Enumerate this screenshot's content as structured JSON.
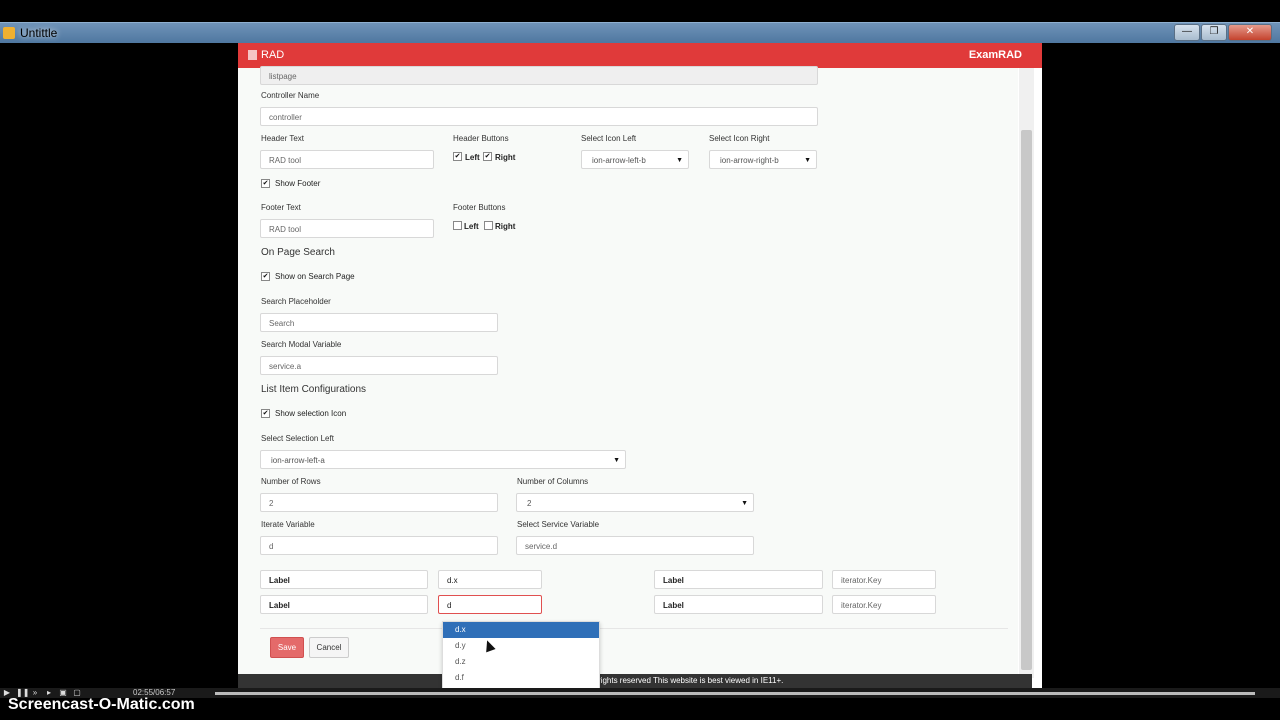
{
  "window": {
    "title": "Untittle"
  },
  "app": {
    "brand": "RAD",
    "right_title": "ExamRAD"
  },
  "form": {
    "top_field": "listpage",
    "controller_label": "Controller Name",
    "controller_value": "controller",
    "header_text_label": "Header Text",
    "header_text_value": "RAD tool",
    "header_buttons_label": "Header Buttons",
    "header_left": "Left",
    "header_right": "Right",
    "select_icon_left_label": "Select Icon Left",
    "select_icon_left_value": "ion-arrow-left-b",
    "select_icon_right_label": "Select Icon Right",
    "select_icon_right_value": "ion-arrow-right-b",
    "show_footer": "Show Footer",
    "footer_text_label": "Footer Text",
    "footer_text_value": "RAD tool",
    "footer_buttons_label": "Footer Buttons",
    "footer_left": "Left",
    "footer_right": "Right",
    "on_page_search": "On Page Search",
    "show_on_search": "Show on Search Page",
    "search_placeholder_label": "Search Placeholder",
    "search_placeholder_value": "Search",
    "search_modal_label": "Search Modal Variable",
    "search_modal_value": "service.a",
    "list_item_config": "List Item Configurations",
    "show_selection_icon": "Show selection Icon",
    "select_selection_left_label": "Select Selection Left",
    "select_selection_left_value": "ion-arrow-left-a",
    "num_rows_label": "Number of Rows",
    "num_rows_value": "2",
    "num_cols_label": "Number of Columns",
    "num_cols_value": "2",
    "iterate_var_label": "Iterate Variable",
    "iterate_var_value": "d",
    "select_service_label": "Select Service Variable",
    "select_service_value": "service.d",
    "rows": [
      {
        "label": "Label",
        "value": "d.x",
        "label2": "Label",
        "key": "iterator.Key"
      },
      {
        "label": "Label",
        "value": "d",
        "label2": "Label",
        "key": "iterator.Key"
      }
    ],
    "save": "Save",
    "cancel": "Cancel"
  },
  "dropdown": [
    "d.x",
    "d.y",
    "d.z",
    "d.f"
  ],
  "footer_text": "rights reserved This website is best viewed in IE11+.",
  "player": {
    "time": "02:55/06:57"
  },
  "watermark": "Screencast-O-Matic.com"
}
